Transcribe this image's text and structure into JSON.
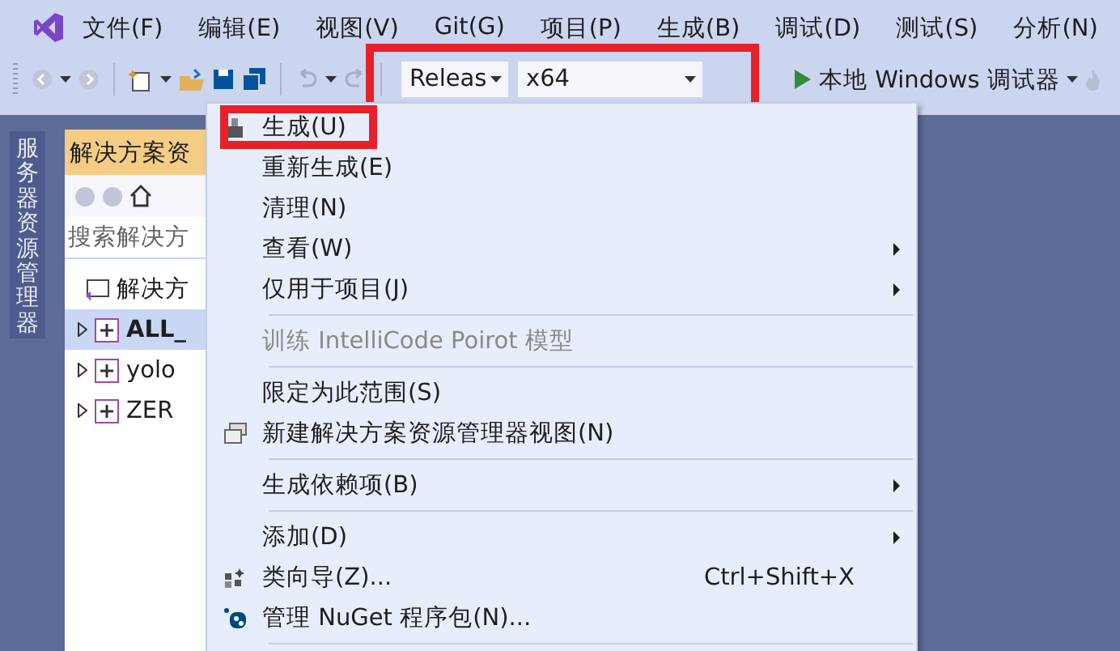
{
  "menubar": {
    "items": [
      "文件(F)",
      "编辑(E)",
      "视图(V)",
      "Git(G)",
      "项目(P)",
      "生成(B)",
      "调试(D)",
      "测试(S)",
      "分析(N)"
    ]
  },
  "toolbar": {
    "configuration": "Releas",
    "platform": "x64",
    "highlighted": true,
    "debugger": "本地 Windows 调试器"
  },
  "side_tab": {
    "label": "服务器资源管理器"
  },
  "solution_explorer": {
    "title": "解决方案资",
    "search": {
      "placeholder": "搜索解决方"
    },
    "tree": [
      {
        "label": "解决方",
        "kind": "solution",
        "selected": false,
        "bold": false
      },
      {
        "label": "ALL_",
        "kind": "project",
        "selected": true,
        "bold": true
      },
      {
        "label": "yolo",
        "kind": "project",
        "selected": false,
        "bold": false
      },
      {
        "label": "ZER",
        "kind": "project",
        "selected": false,
        "bold": false
      }
    ]
  },
  "context_menu": {
    "items": [
      {
        "kind": "item",
        "label": "生成(U)",
        "highlighted": true,
        "disabled": false,
        "submenu": false
      },
      {
        "kind": "item",
        "label": "重新生成(E)",
        "disabled": false,
        "submenu": false
      },
      {
        "kind": "item",
        "label": "清理(N)",
        "disabled": false,
        "submenu": false
      },
      {
        "kind": "item",
        "label": "查看(W)",
        "disabled": false,
        "submenu": true
      },
      {
        "kind": "item",
        "label": "仅用于项目(J)",
        "disabled": false,
        "submenu": true
      },
      {
        "kind": "separator"
      },
      {
        "kind": "item",
        "label": "训练 IntelliCode Poirot 模型",
        "disabled": true,
        "submenu": false
      },
      {
        "kind": "separator"
      },
      {
        "kind": "item",
        "label": "限定为此范围(S)",
        "disabled": false,
        "submenu": false
      },
      {
        "kind": "item",
        "label": "新建解决方案资源管理器视图(N)",
        "disabled": false,
        "submenu": false
      },
      {
        "kind": "separator"
      },
      {
        "kind": "item",
        "label": "生成依赖项(B)",
        "disabled": false,
        "submenu": true
      },
      {
        "kind": "separator"
      },
      {
        "kind": "item",
        "label": "添加(D)",
        "disabled": false,
        "submenu": true
      },
      {
        "kind": "item",
        "label": "类向导(Z)...",
        "shortcut": "Ctrl+Shift+X",
        "disabled": false,
        "submenu": false
      },
      {
        "kind": "item",
        "label": "管理 NuGet 程序包(N)...",
        "disabled": false,
        "submenu": false
      },
      {
        "kind": "separator"
      }
    ]
  }
}
